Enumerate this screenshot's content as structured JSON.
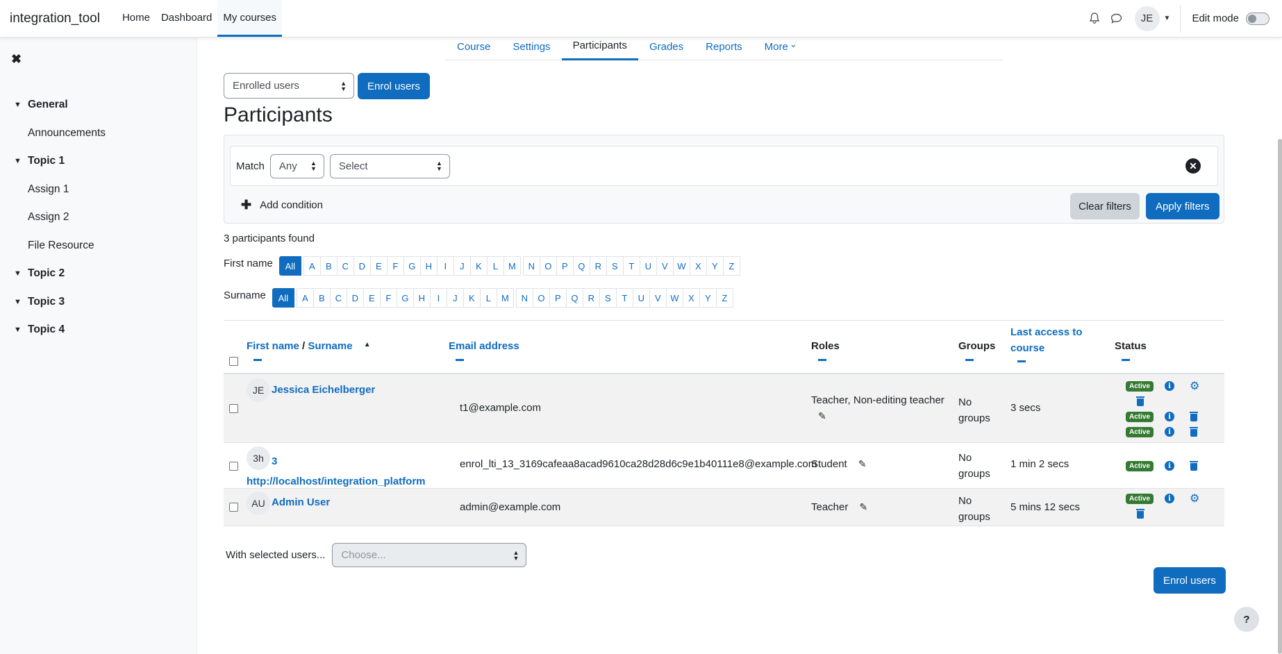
{
  "navbar": {
    "brand": "integration_tool",
    "links": [
      "Home",
      "Dashboard",
      "My courses"
    ],
    "active_link": "My courses",
    "avatar_initials": "JE",
    "edit_mode_label": "Edit mode",
    "icons": [
      "bell-icon",
      "chat-icon"
    ]
  },
  "drawer": {
    "sections": [
      {
        "title": "General",
        "items": [
          "Announcements"
        ]
      },
      {
        "title": "Topic 1",
        "items": [
          "Assign 1",
          "Assign 2",
          "File Resource"
        ]
      },
      {
        "title": "Topic 2",
        "items": []
      },
      {
        "title": "Topic 3",
        "items": []
      },
      {
        "title": "Topic 4",
        "items": []
      }
    ]
  },
  "course_nav": {
    "tabs": [
      "Course",
      "Settings",
      "Participants",
      "Grades",
      "Reports",
      "More"
    ],
    "active": "Participants"
  },
  "toolbar": {
    "enrolled_select": "Enrolled users",
    "enrol_button": "Enrol users"
  },
  "page_title": "Participants",
  "filter": {
    "match_label": "Match",
    "match_value": "Any",
    "select_value": "Select",
    "add_condition": "Add condition",
    "clear_filters": "Clear filters",
    "apply_filters": "Apply filters"
  },
  "found_text": "3 participants found",
  "initials": {
    "first_name_label": "First name",
    "surname_label": "Surname",
    "all_label": "All",
    "letters": [
      "A",
      "B",
      "C",
      "D",
      "E",
      "F",
      "G",
      "H",
      "I",
      "J",
      "K",
      "L",
      "M",
      "N",
      "O",
      "P",
      "Q",
      "R",
      "S",
      "T",
      "U",
      "V",
      "W",
      "X",
      "Y",
      "Z"
    ]
  },
  "table": {
    "headers": {
      "first_name": "First name",
      "separator": "/",
      "surname": "Surname",
      "email": "Email address",
      "roles": "Roles",
      "groups": "Groups",
      "last_access": "Last access to course",
      "status": "Status"
    },
    "rows": [
      {
        "initials": "JE",
        "name": "Jessica Eichelberger",
        "email": "t1@example.com",
        "roles": "Teacher, Non-editing teacher",
        "groups": "No groups",
        "last_access": "3 secs",
        "statuses": [
          "Active",
          "Active",
          "Active"
        ]
      },
      {
        "initials": "3h",
        "name": "3 http://localhost/integration_platform",
        "email": "enrol_lti_13_3169cafeaa8acad9610ca28d28d6c9e1b40111e8@example.com",
        "roles": "Student",
        "groups": "No groups",
        "last_access": "1 min 2 secs",
        "statuses": [
          "Active"
        ]
      },
      {
        "initials": "AU",
        "name": "Admin User",
        "email": "admin@example.com",
        "roles": "Teacher",
        "groups": "No groups",
        "last_access": "5 mins 12 secs",
        "statuses": [
          "Active"
        ]
      }
    ]
  },
  "bulk": {
    "label": "With selected users...",
    "placeholder": "Choose..."
  },
  "bottom_enrol_button": "Enrol users",
  "help_label": "?"
}
